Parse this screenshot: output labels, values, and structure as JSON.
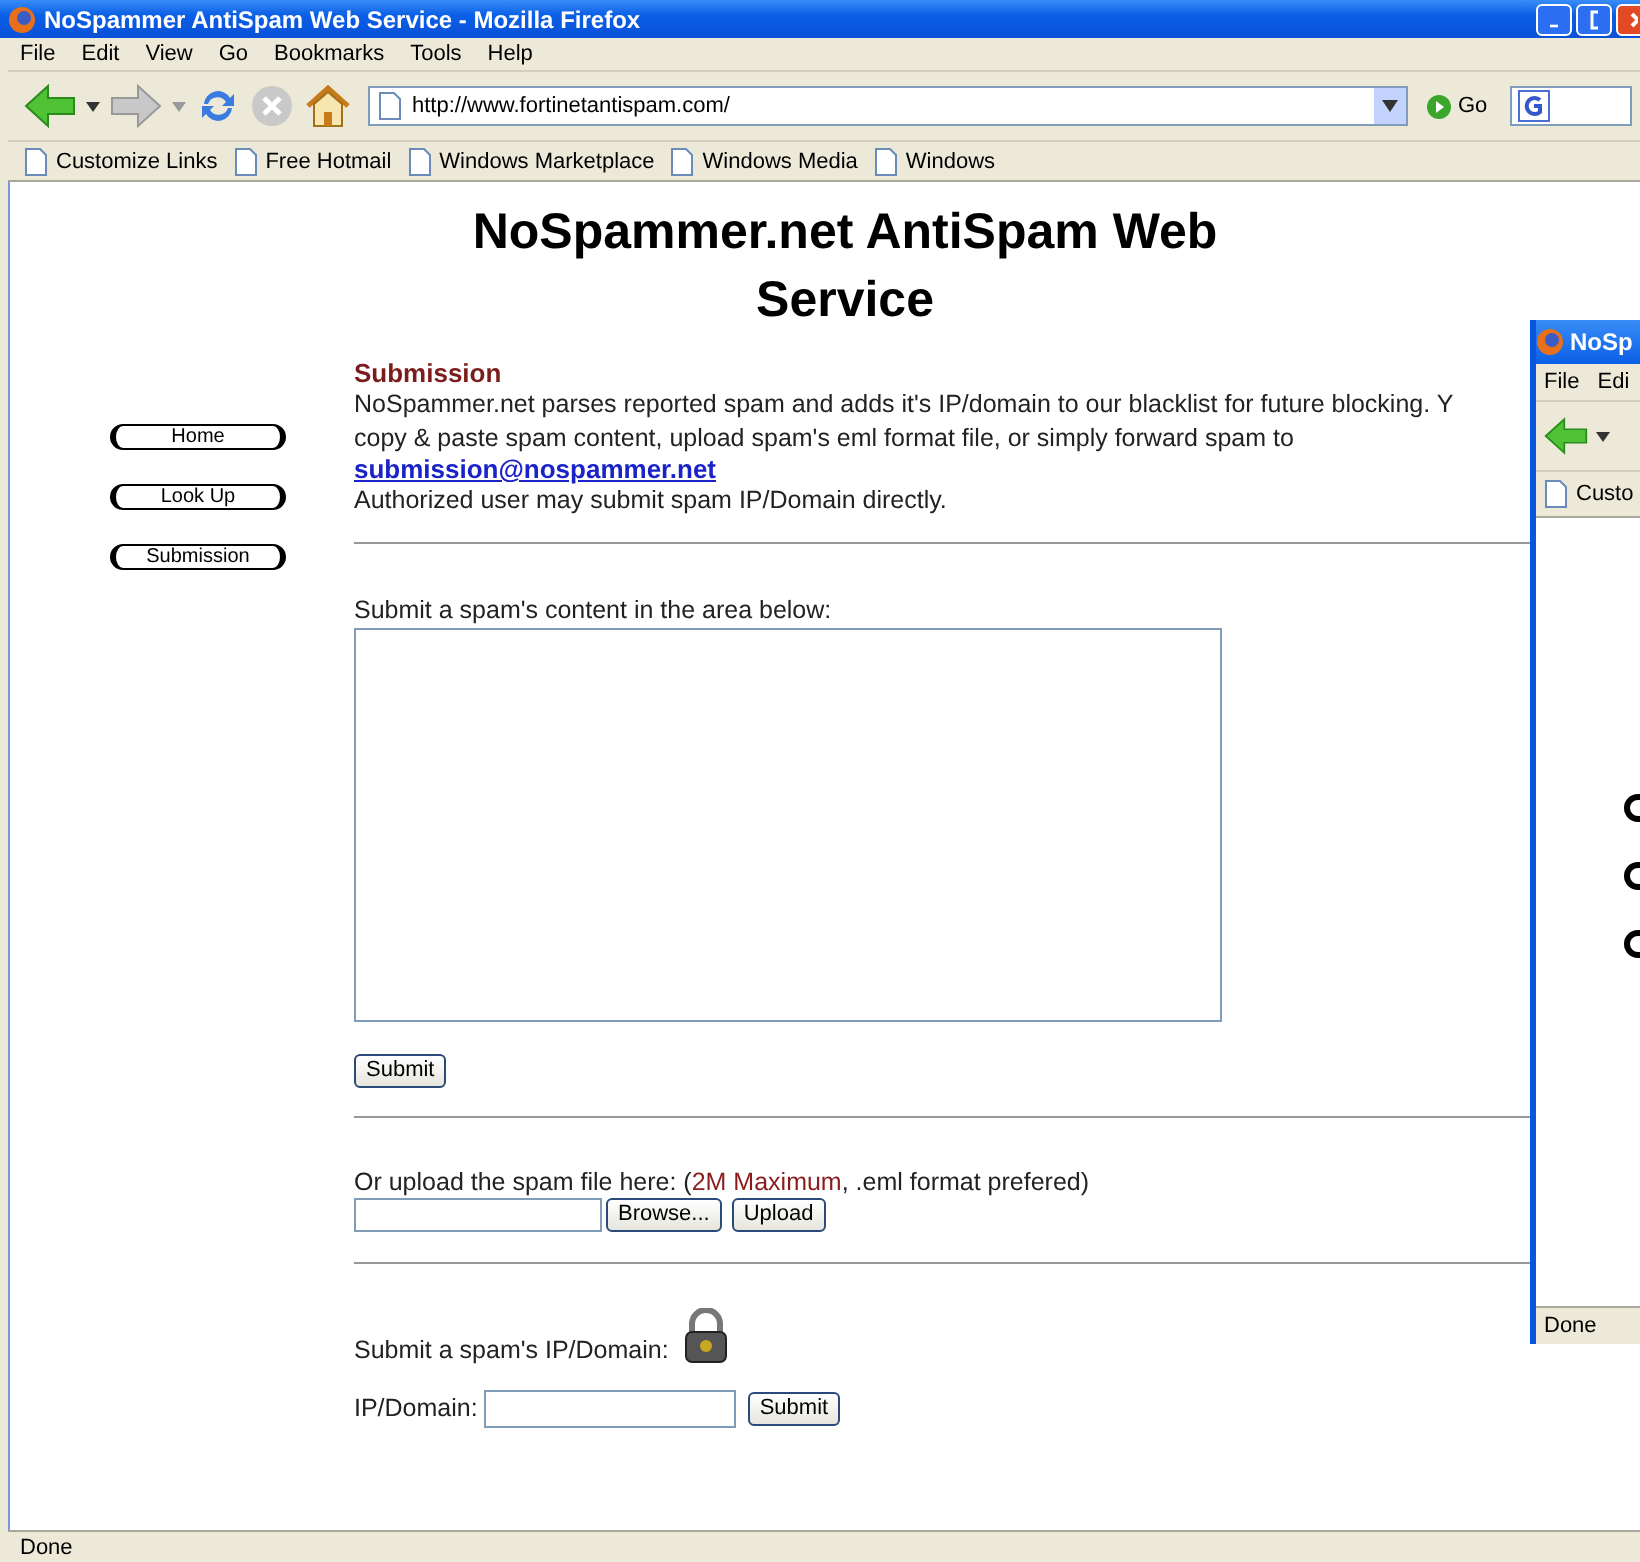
{
  "window": {
    "title": "NoSpammer AntiSpam Web Service - Mozilla Firefox"
  },
  "menu": [
    "File",
    "Edit",
    "View",
    "Go",
    "Bookmarks",
    "Tools",
    "Help"
  ],
  "toolbar": {
    "url": "http://www.fortinetantispam.com/",
    "go_label": "Go"
  },
  "bookmarks": [
    "Customize Links",
    "Free Hotmail",
    "Windows Marketplace",
    "Windows Media",
    "Windows"
  ],
  "page": {
    "title": "NoSpammer.net AntiSpam Web Service",
    "nav": [
      "Home",
      "Look Up",
      "Submission"
    ],
    "heading": "Submission",
    "intro_lines": [
      "NoSpammer.net parses reported spam and adds it's IP/domain to our blacklist for future blocking. Y",
      "copy & paste spam content, upload spam's eml format file, or simply forward spam to"
    ],
    "email_link": "submission@nospammer.net",
    "note": "Authorized user may submit spam IP/Domain directly.",
    "content_form": {
      "label": "Submit a spam's content in the area below:",
      "button": "Submit"
    },
    "upload_form": {
      "label_start": "Or upload the spam file here: (",
      "limit": "2M Maximum",
      "label_end": ", .eml format prefered)",
      "browse": "Browse...",
      "upload": "Upload"
    },
    "ip_form": {
      "heading": "Submit a spam's IP/Domain:",
      "label": "IP/Domain:",
      "button": "Submit"
    }
  },
  "status_bar": "Done",
  "second_window": {
    "title": "NoSp",
    "menu": [
      "File",
      "Edi"
    ],
    "bookmark": "Custo",
    "status_bar": "Done"
  }
}
